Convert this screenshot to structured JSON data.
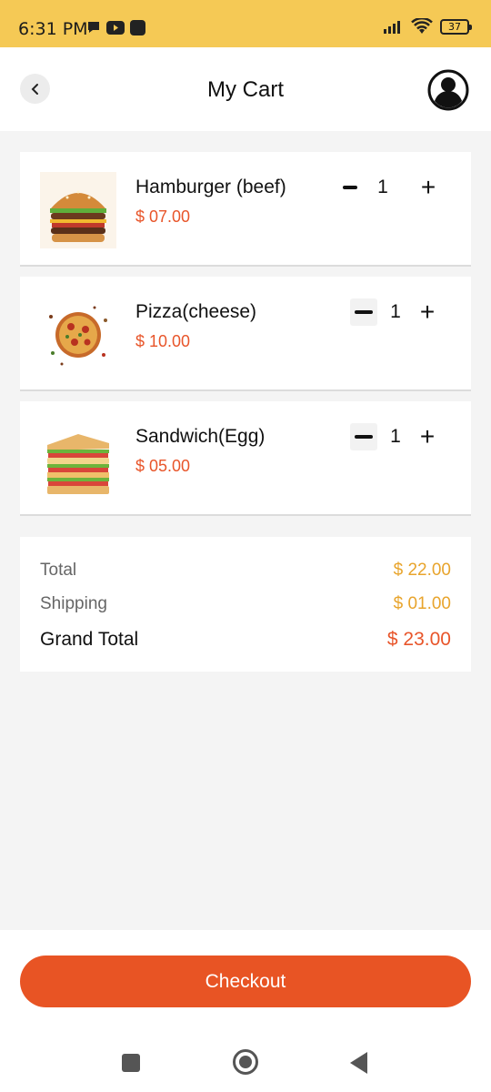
{
  "status_bar": {
    "time": "6:31 PM",
    "battery": "37",
    "icons": [
      "chat-bubble-icon",
      "youtube-icon",
      "app-icon",
      "signal-icon",
      "wifi-icon",
      "battery-icon"
    ]
  },
  "header": {
    "title": "My Cart",
    "back_icon": "chevron-left-icon",
    "profile_icon": "user-avatar-icon"
  },
  "cart_items": [
    {
      "name": "Hamburger (beef)",
      "price": "$ 07.00",
      "quantity": "1",
      "image": "hamburger-image"
    },
    {
      "name": "Pizza(cheese)",
      "price": "$ 10.00",
      "quantity": "1",
      "image": "pizza-image"
    },
    {
      "name": "Sandwich(Egg)",
      "price": "$ 05.00",
      "quantity": "1",
      "image": "sandwich-image"
    }
  ],
  "summary": {
    "total_label": "Total",
    "total_value": "$ 22.00",
    "shipping_label": "Shipping",
    "shipping_value": "$ 01.00",
    "grand_total_label": "Grand Total",
    "grand_total_value": "$ 23.00"
  },
  "checkout": {
    "label": "Checkout"
  },
  "colors": {
    "status_bar": "#f5c955",
    "accent": "#e85424",
    "price": "#e8552a",
    "summary_value": "#e8a42c"
  }
}
